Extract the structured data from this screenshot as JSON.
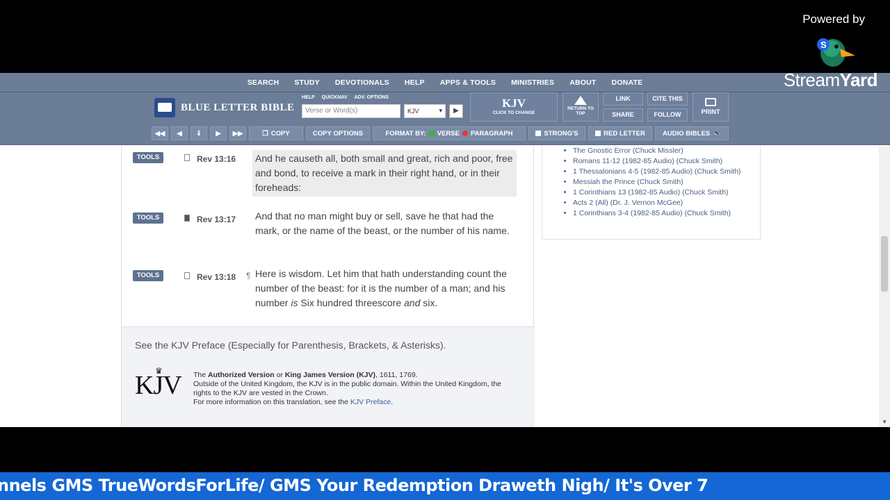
{
  "streamyard": {
    "powered_by": "Powered by",
    "name_thin": "Stream",
    "name_bold": "Yard"
  },
  "topnav": [
    "SEARCH",
    "STUDY",
    "DEVOTIONALS",
    "HELP",
    "APPS & TOOLS",
    "MINISTRIES",
    "ABOUT",
    "DONATE"
  ],
  "toolbar": {
    "logo": "BLUE LETTER BIBLE",
    "mini_links": [
      "HELP",
      "QUICKNAV",
      "ADV. OPTIONS"
    ],
    "search_placeholder": "Verse or Word(s)",
    "version": "KJV",
    "kjv_big": "KJV",
    "kjv_small": "CLICK TO CHANGE",
    "return_top": "RETURN TO TOP",
    "link": "LINK",
    "cite": "CITE THIS",
    "share": "SHARE",
    "follow": "FOLLOW",
    "print": "PRINT"
  },
  "controls": {
    "copy": "COPY",
    "copy_options": "COPY OPTIONS",
    "format_by": "FORMAT BY:",
    "verse": "VERSE",
    "paragraph": "PARAGRAPH",
    "strongs": "STRONG'S",
    "red_letter": "RED LETTER",
    "audio_bibles": "AUDIO BIBLES"
  },
  "verses": [
    {
      "tools": "TOOLS",
      "ref": "Rev 13:16",
      "text": "And he causeth all, both small and great, rich and poor, free and bond, to receive a mark in their right hand, or in their foreheads:",
      "highlighted": true
    },
    {
      "tools": "TOOLS",
      "ref": "Rev 13:17",
      "text": "And that no man might buy or sell, save he that had the mark, or the name of the beast, or the number of his name.",
      "highlighted": false
    },
    {
      "tools": "TOOLS",
      "ref": "Rev 13:18",
      "para_mark": "¶",
      "text_a": "Here is wisdom. Let him that hath understanding count the number of the beast: for it is the number of a man; and his number ",
      "text_i1": "is",
      "text_b": " Six hundred threescore ",
      "text_i2": "and",
      "text_c": " six.",
      "highlighted": false
    }
  ],
  "preface": {
    "link": "See the KJV Preface (Especially for Parenthesis, Brackets, & Asterisks).",
    "logo": "KJV",
    "line1_pre": "The ",
    "line1_b1": "Authorized Version",
    "line1_mid": " or ",
    "line1_b2": "King James Version (KJV)",
    "line1_post": ", 1611, 1769.",
    "line2": "Outside of the United Kingdom, the KJV is in the public domain. Within the United Kingdom, the rights to the KJV are vested in the Crown.",
    "line3_pre": "For more information on this translation, see the ",
    "line3_link": "KJV Preface",
    "line3_post": "."
  },
  "sidebar_items": [
    "The Gnostic Error (Chuck Missler)",
    "Romans 11-12 (1982-85 Audio) (Chuck Smith)",
    "1 Thessalonians 4-5 (1982-85 Audio) (Chuck Smith)",
    "Messiah the Prince (Chuck Smith)",
    "1 Corinthians 13 (1982-85 Audio) (Chuck Smith)",
    "Acts 2 (All) (Dr. J. Vernon McGee)",
    "1 Corinthians 3-4 (1982-85 Audio) (Chuck Smith)"
  ],
  "ticker": "nnels GMS TrueWordsForLife/ GMS Your Redemption Draweth Nigh/ It's Over 7"
}
